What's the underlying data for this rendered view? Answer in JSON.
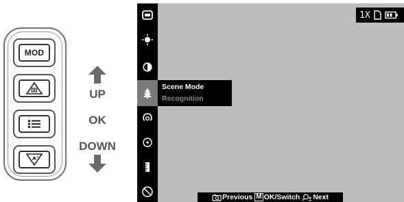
{
  "remote": {
    "mod_label": "MOD",
    "buttons": [
      "mod-button",
      "camera-button",
      "menu-button",
      "down-button"
    ]
  },
  "directions": {
    "up": "UP",
    "ok": "OK",
    "down": "DOWN"
  },
  "screen": {
    "zoom": "1X",
    "menu_items": [
      "display-mode-icon",
      "brightness-icon",
      "contrast-icon",
      "scene-mode-icon",
      "hotspot-icon",
      "target-mark-icon",
      "rangefinder-icon",
      "disable-icon"
    ],
    "active_index": 3,
    "popup": {
      "selected": "Scene Mode",
      "option": "Recognition"
    },
    "hints": {
      "previous": "Previous",
      "switch_key": "M",
      "switch": "OK/Switch",
      "next": "Next"
    }
  }
}
